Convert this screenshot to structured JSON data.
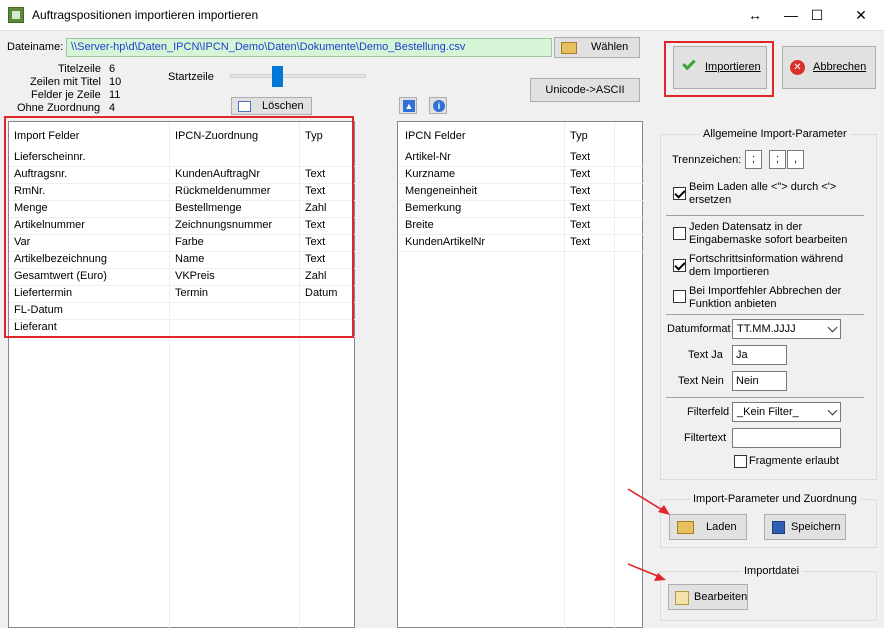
{
  "window": {
    "title": "Auftragspositionen importieren importieren",
    "resize_glyph": "↔",
    "minimize_glyph": "—",
    "maximize_glyph": "☐",
    "close_glyph": "✕"
  },
  "file": {
    "label": "Dateiname:",
    "path": "\\\\Server-hp\\d\\Daten_IPCN\\IPCN_Demo\\Daten\\Dokumente\\Demo_Bestellung.csv",
    "choose_label": "Wählen"
  },
  "stats": {
    "title_row_label": "Titelzeile",
    "title_row_value": "6",
    "rows_with_title_label": "Zeilen mit Titel",
    "rows_with_title_value": "10",
    "fields_per_row_label": "Felder je Zeile",
    "fields_per_row_value": "11",
    "without_assignment_label": "Ohne Zuordnung",
    "without_assignment_value": "4",
    "start_row_label": "Startzeile"
  },
  "toolbar": {
    "delete_label": "Löschen",
    "unicode_label": "Unicode->ASCII",
    "import_label": "Importieren",
    "cancel_label": "Abbrechen"
  },
  "import_table": {
    "headers": [
      "Import Felder",
      "IPCN-Zuordnung",
      "Typ"
    ],
    "rows": [
      [
        "Lieferscheinnr.",
        "",
        ""
      ],
      [
        "Auftragsnr.",
        "KundenAuftragNr",
        "Text"
      ],
      [
        "RmNr.",
        "Rückmeldenummer",
        "Text"
      ],
      [
        "Menge",
        "Bestellmenge",
        "Zahl"
      ],
      [
        "Artikelnummer",
        "Zeichnungsnummer",
        "Text"
      ],
      [
        "Var",
        "Farbe",
        "Text"
      ],
      [
        "Artikelbezeichnung",
        "Name",
        "Text"
      ],
      [
        "Gesamtwert (Euro)",
        "VKPreis",
        "Zahl"
      ],
      [
        "Liefertermin",
        "Termin",
        "Datum"
      ],
      [
        "FL-Datum",
        "",
        ""
      ],
      [
        "Lieferant",
        "",
        ""
      ]
    ]
  },
  "ipcn_table": {
    "headers": [
      "IPCN Felder",
      "Typ"
    ],
    "rows": [
      [
        "Artikel-Nr",
        "Text"
      ],
      [
        "Kurzname",
        "Text"
      ],
      [
        "Mengeneinheit",
        "Text"
      ],
      [
        "Bemerkung",
        "Text"
      ],
      [
        "Breite",
        "Text"
      ],
      [
        "KundenArtikelNr",
        "Text"
      ]
    ]
  },
  "params": {
    "group_title": "Allgemeine Import-Parameter",
    "separator_label": "Trennzeichen:",
    "separators": [
      ";",
      ";",
      ","
    ],
    "opt_replace": "Beim Laden alle <\"> durch <'> ersetzen",
    "opt_replace_line2": "ersetzen",
    "opt_replace_line1": "Beim Laden alle <\"> durch <'>",
    "opt_edit_line1": "Jeden Datensatz in der",
    "opt_edit_line2": "Eingabemaske sofort bearbeiten",
    "opt_progress_line1": "Fortschrittsinformation während",
    "opt_progress_line2": "dem Importieren",
    "opt_abort_line1": "Bei Importfehler Abbrechen der",
    "opt_abort_line2": "Funktion anbieten",
    "checked": [
      true,
      false,
      true,
      false
    ],
    "date_format_label": "Datumformat",
    "date_format_value": "TT.MM.JJJJ",
    "text_yes_label": "Text Ja",
    "text_yes_value": "Ja",
    "text_no_label": "Text Nein",
    "text_no_value": "Nein",
    "filter_field_label": "Filterfeld",
    "filter_field_value": "_Kein Filter_",
    "filter_text_label": "Filtertext",
    "filter_text_value": "",
    "fragments_label": "Fragmente erlaubt"
  },
  "mapping_group": {
    "title": "Import-Parameter und Zuordnung",
    "load_label": "Laden",
    "save_label": "Speichern"
  },
  "importfile_group": {
    "title": "Importdatei",
    "edit_label": "Bearbeiten"
  },
  "colors": {
    "accent_red": "#e0262b",
    "path_bg": "#d6f5d6",
    "path_text": "#1a3fd1"
  }
}
